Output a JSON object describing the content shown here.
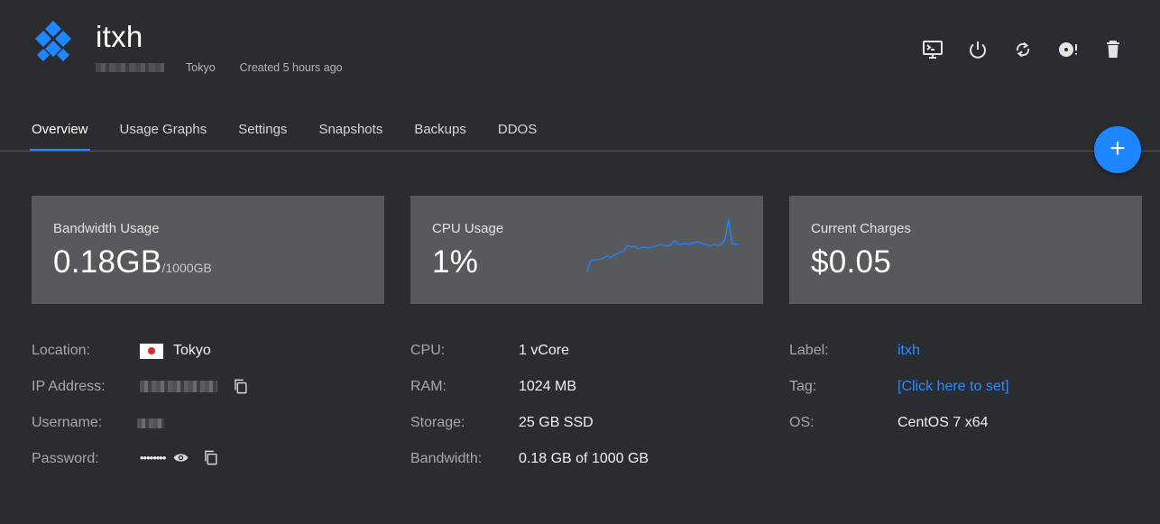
{
  "header": {
    "title": "itxh",
    "location": "Tokyo",
    "created": "Created 5 hours ago"
  },
  "toolbar": {
    "icons": [
      "console-icon",
      "power-icon",
      "restart-icon",
      "iso-disc-icon",
      "trash-icon"
    ]
  },
  "tabs": [
    {
      "label": "Overview",
      "active": true
    },
    {
      "label": "Usage Graphs",
      "active": false
    },
    {
      "label": "Settings",
      "active": false
    },
    {
      "label": "Snapshots",
      "active": false
    },
    {
      "label": "Backups",
      "active": false
    },
    {
      "label": "DDOS",
      "active": false
    }
  ],
  "fab": {
    "label": "+"
  },
  "cards": {
    "bandwidth": {
      "label": "Bandwidth Usage",
      "value": "0.18GB",
      "unit": "/1000GB"
    },
    "cpu": {
      "label": "CPU Usage",
      "value": "1%"
    },
    "charges": {
      "label": "Current Charges",
      "value": "$0.05"
    }
  },
  "cpu_sparkline": [
    0,
    12,
    13,
    14,
    14,
    16,
    18,
    16,
    19,
    20,
    22,
    24,
    30,
    28,
    29,
    26,
    27,
    28,
    27,
    28,
    29,
    30,
    31,
    30,
    29,
    31,
    36,
    31,
    31,
    32,
    31,
    32,
    33,
    34,
    32,
    31,
    30,
    30,
    31,
    30,
    31,
    38,
    60,
    32,
    31,
    32
  ],
  "details": {
    "col1": {
      "location_label": "Location:",
      "location_value": "Tokyo",
      "ip_label": "IP Address:",
      "username_label": "Username:",
      "password_label": "Password:",
      "password_value": "••••••••"
    },
    "col2": {
      "cpu_label": "CPU:",
      "cpu_value": "1 vCore",
      "ram_label": "RAM:",
      "ram_value": "1024 MB",
      "storage_label": "Storage:",
      "storage_value": "25 GB SSD",
      "bandwidth_label": "Bandwidth:",
      "bandwidth_value": "0.18 GB of 1000 GB"
    },
    "col3": {
      "label_label": "Label:",
      "label_value": "itxh",
      "tag_label": "Tag:",
      "tag_value": "[Click here to set]",
      "os_label": "OS:",
      "os_value": "CentOS 7 x64"
    }
  },
  "colors": {
    "background": "#2b2c30",
    "card": "#58595c",
    "accent": "#1e86ff",
    "link": "#2e8bff"
  }
}
